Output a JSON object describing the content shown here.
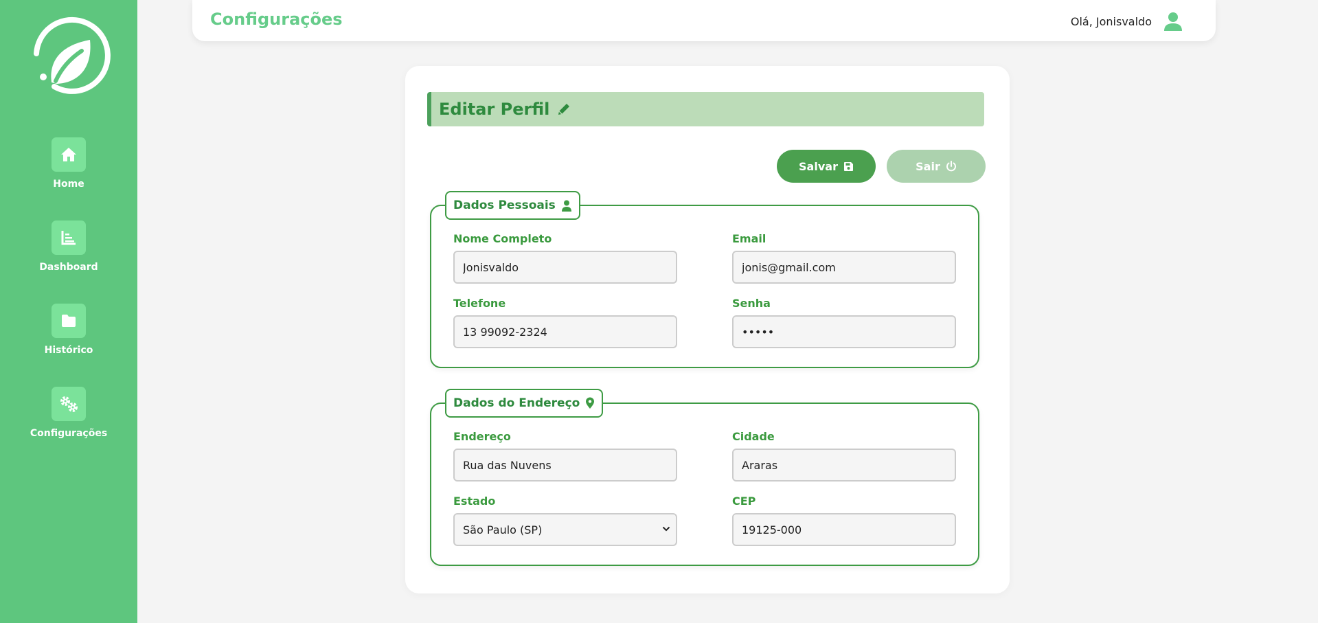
{
  "sidebar": {
    "logo": "leaf-logo",
    "items": [
      {
        "label": "Home",
        "icon": "home-icon"
      },
      {
        "label": "Dashboard",
        "icon": "chart-icon"
      },
      {
        "label": "Histórico",
        "icon": "folder-icon"
      },
      {
        "label": "Configurações",
        "icon": "gears-icon"
      }
    ]
  },
  "header": {
    "title": "Configurações",
    "greeting": "Olá, Jonisvaldo",
    "user_icon": "user-icon"
  },
  "profile": {
    "title": "Editar Perfil",
    "save_label": "Salvar",
    "exit_label": "Sair",
    "personal": {
      "legend": "Dados Pessoais",
      "name_label": "Nome Completo",
      "name_value": "Jonisvaldo",
      "email_label": "Email",
      "email_value": "jonis@gmail.com",
      "phone_label": "Telefone",
      "phone_value": "13 99092-2324",
      "password_label": "Senha",
      "password_value": "•••••"
    },
    "address": {
      "legend": "Dados do Endereço",
      "street_label": "Endereço",
      "street_value": "Rua das Nuvens",
      "city_label": "Cidade",
      "city_value": "Araras",
      "state_label": "Estado",
      "state_value": "São Paulo (SP)",
      "cep_label": "CEP",
      "cep_value": "19125-000"
    }
  },
  "colors": {
    "sidebar_bg": "#5ec67e",
    "accent": "#3e9b44",
    "title_green": "#66cc8a"
  }
}
